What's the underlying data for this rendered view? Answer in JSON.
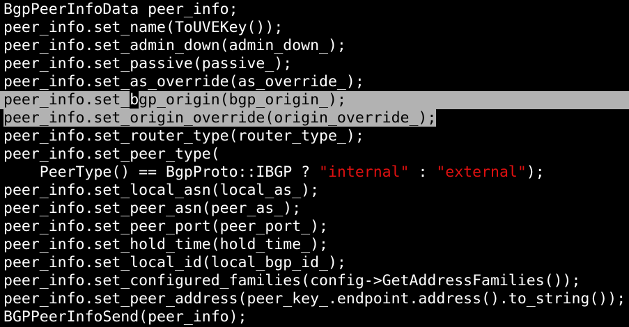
{
  "editor": {
    "lines": [
      {
        "text": "BgpPeerInfoData peer_info;"
      },
      {
        "text": "peer_info.set_name(ToUVEKey());"
      },
      {
        "text": "peer_info.set_admin_down(admin_down_);"
      },
      {
        "text": "peer_info.set_passive(passive_);"
      },
      {
        "text": "peer_info.set_as_override(as_override_);"
      },
      {
        "before": "peer_info.set_",
        "cursor": "b",
        "after": "gp_origin(bgp_origin_);"
      },
      {
        "text": "peer_info.set_origin_override(origin_override_);"
      },
      {
        "text": "peer_info.set_router_type(router_type_);"
      },
      {
        "text": "peer_info.set_peer_type("
      },
      {
        "pre": "    PeerType() == BgpProto::IBGP ? ",
        "str1": "\"internal\"",
        "mid": " : ",
        "str2": "\"external\"",
        "post": ");"
      },
      {
        "text": "peer_info.set_local_asn(local_as_);"
      },
      {
        "text": "peer_info.set_peer_asn(peer_as_);"
      },
      {
        "text": "peer_info.set_peer_port(peer_port_);"
      },
      {
        "text": "peer_info.set_hold_time(hold_time_);"
      },
      {
        "text": "peer_info.set_local_id(local_bgp_id_);"
      },
      {
        "text": "peer_info.set_configured_families(config->GetAddressFamilies());"
      },
      {
        "text": "peer_info.set_peer_address(peer_key_.endpoint.address().to_string());"
      },
      {
        "text": "BGPPeerInfoSend(peer_info);"
      }
    ]
  },
  "colors": {
    "background": "#000000",
    "text": "#ffffff",
    "string_literal": "#e01010",
    "selection": "#b2b2b2"
  }
}
